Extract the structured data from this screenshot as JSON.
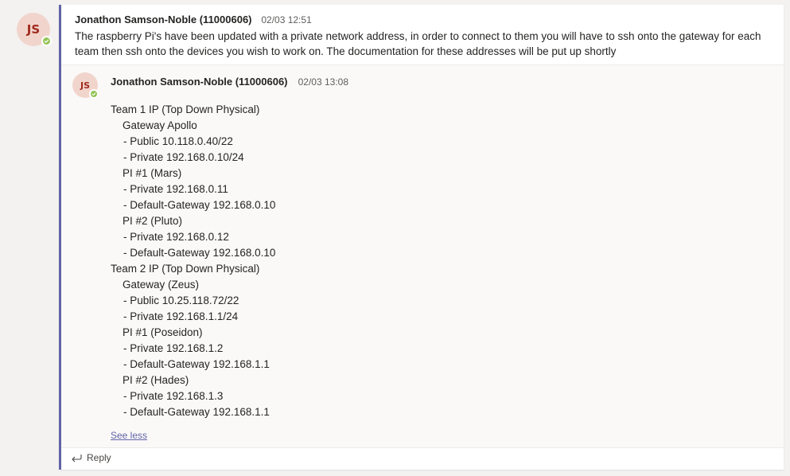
{
  "post": {
    "avatar_initials": "JS",
    "author": "Jonathon Samson-Noble (11000606)",
    "timestamp": "02/03 12:51",
    "body": "The raspberry Pi's have been updated with a private network address, in order to connect to them you will have to ssh onto the gateway for each team then ssh onto the devices you wish to work on. The documentation for these addresses will be put up shortly"
  },
  "reply": {
    "avatar_initials": "JS",
    "author": "Jonathon Samson-Noble (11000606)",
    "timestamp": "02/03 13:08",
    "lines": [
      "Team 1 IP (Top Down Physical)",
      "Gateway Apollo",
      "- Public 10.118.0.40/22",
      "- Private 192.168.0.10/24",
      "PI #1 (Mars)",
      "- Private 192.168.0.11",
      "- Default-Gateway 192.168.0.10",
      "PI #2 (Pluto)",
      "- Private 192.168.0.12",
      "- Default-Gateway 192.168.0.10",
      "Team 2 IP (Top Down Physical)",
      "Gateway (Zeus)",
      "- Public 10.25.118.72/22",
      "- Private 192.168.1.1/24",
      "PI #1 (Poseidon)",
      "- Private 192.168.1.2",
      "- Default-Gateway 192.168.1.1",
      "PI #2 (Hades)",
      "- Private 192.168.1.3",
      "- Default-Gateway 192.168.1.1"
    ],
    "see_less_label": "See less"
  },
  "reply_bar": {
    "label": "Reply",
    "icon": "reply-arrow-icon"
  },
  "colors": {
    "accent": "#6264a7",
    "presence_available": "#92c353",
    "avatar_bg": "#f1d5cc",
    "avatar_text": "#a02a1d"
  }
}
